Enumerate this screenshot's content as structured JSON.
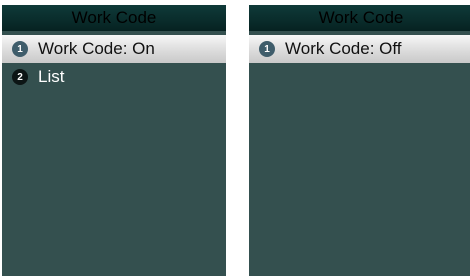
{
  "screens": [
    {
      "title": "Work Code",
      "items": [
        {
          "number": "1",
          "label": "Work Code: On",
          "selected": true
        },
        {
          "number": "2",
          "label": "List",
          "selected": false
        }
      ]
    },
    {
      "title": "Work Code",
      "items": [
        {
          "number": "1",
          "label": "Work Code: Off",
          "selected": true
        }
      ]
    }
  ],
  "colors": {
    "screen_background": "#34504f",
    "titlebar": "#0a2d2c",
    "selected_item": "#dcdcdc",
    "badge_selected": "#3f5d6b",
    "badge_normal": "#0c1515"
  }
}
